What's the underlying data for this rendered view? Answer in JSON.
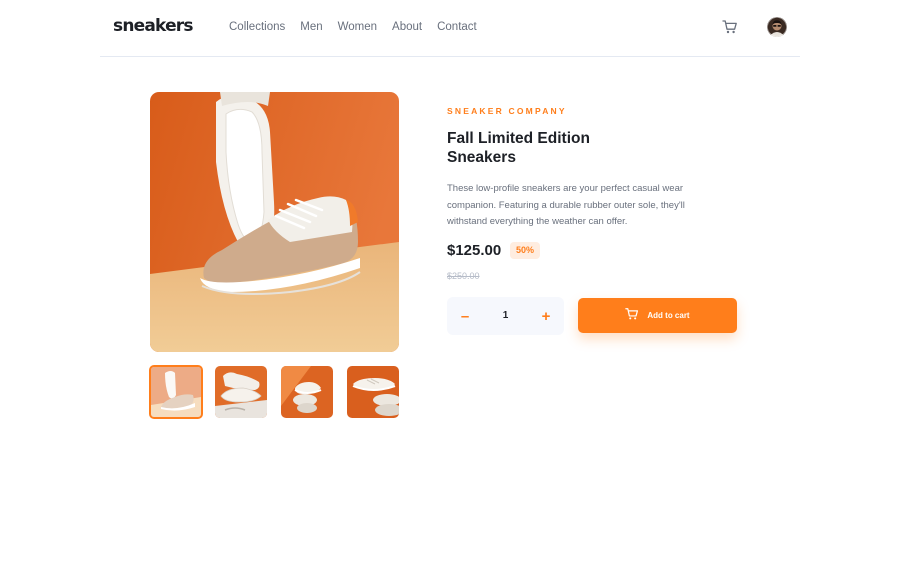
{
  "header": {
    "logo": "sneakers",
    "nav": [
      "Collections",
      "Men",
      "Women",
      "About",
      "Contact"
    ]
  },
  "product": {
    "company": "SNEAKER COMPANY",
    "title_line1": "Fall Limited Edition",
    "title_line2": "Sneakers",
    "description": "These low-profile sneakers are your perfect casual wear companion. Featuring a durable rubber outer sole, they'll withstand everything the weather can offer.",
    "price": "$125.00",
    "discount": "50%",
    "old_price": "$250.00",
    "quantity": "1",
    "minus_label": "–",
    "plus_label": "+",
    "add_to_cart": "Add to cart"
  },
  "colors": {
    "accent": "#ff7e1b",
    "accent_pale": "#ffede0",
    "dark": "#1d2026",
    "grey": "#69707d",
    "light_bg": "#f6f8fd"
  },
  "icons": {
    "cart": "cart-icon",
    "avatar": "avatar",
    "add_cart": "cart-icon"
  }
}
